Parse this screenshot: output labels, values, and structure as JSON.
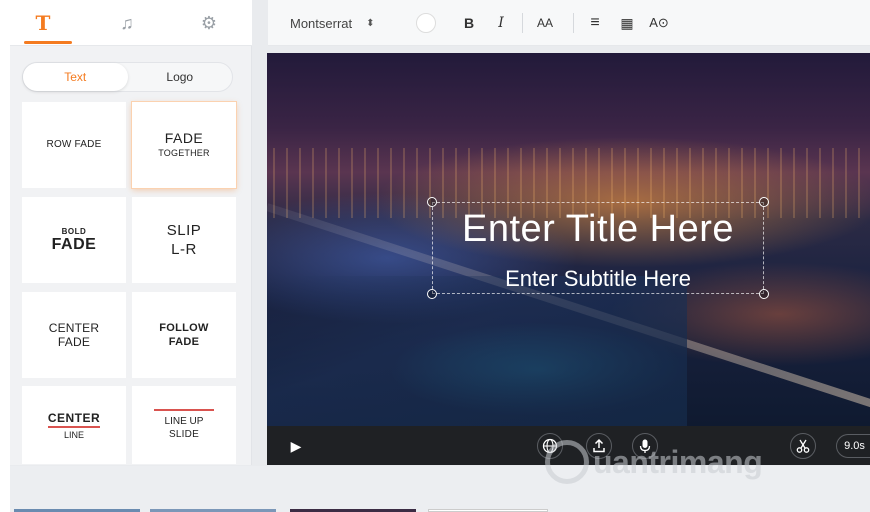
{
  "sidebar": {
    "tabs": [
      {
        "name": "text",
        "glyph": "T"
      },
      {
        "name": "music",
        "glyph": "♫"
      },
      {
        "name": "settings",
        "glyph": "⚙"
      }
    ],
    "segment": {
      "text": "Text",
      "logo": "Logo"
    },
    "styles": [
      {
        "line1": "ROW FADE"
      },
      {
        "line1": "FADE",
        "line2": "TOGETHER"
      },
      {
        "line1": "BOLD",
        "line2": "FADE"
      },
      {
        "line1": "SLIP",
        "line2": "L-R"
      },
      {
        "line1": "CENTER",
        "line2": "FADE"
      },
      {
        "line1": "FOLLOW",
        "line2": "FADE"
      },
      {
        "line1": "CENTER",
        "line2": "LINE"
      },
      {
        "line1": "LINE UP",
        "line2": "SLIDE"
      }
    ]
  },
  "toolbar": {
    "font": "Montserrat",
    "font_caret": "⬍",
    "bold": "B",
    "italic": "I",
    "size": "AA",
    "align": "≡",
    "grid": "▦",
    "effect": "A⊙"
  },
  "video": {
    "title": "Enter Title Here",
    "subtitle": "Enter Subtitle Here"
  },
  "player": {
    "play": "▶",
    "duration": "9.0s"
  },
  "watermark": {
    "text": "uantrimang"
  },
  "colors": {
    "accent": "#f47b20",
    "underline": "#d9534f"
  }
}
